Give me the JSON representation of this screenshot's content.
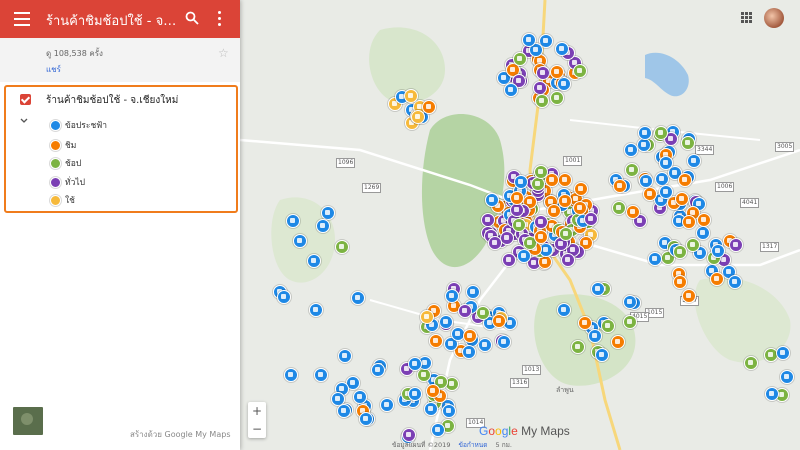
{
  "header": {
    "title": "ร้านค้าชิมช้อปใช้ - จ.เชียงใหม่",
    "color": "#db4437"
  },
  "info": {
    "views": "ดู 108,538 ครั้ง",
    "share": "แชร์"
  },
  "layer": {
    "name": "ร้านค้าชิมช้อปใช้ - จ.เชียงใหม่",
    "items": [
      {
        "label": "ข้อประชฟ้า",
        "color": "#1e88e5"
      },
      {
        "label": "ชิม",
        "color": "#f57c00"
      },
      {
        "label": "ช้อป",
        "color": "#7cb342"
      },
      {
        "label": "ทั่วไป",
        "color": "#7b3fb4"
      },
      {
        "label": "ใช้",
        "color": "#f6b93b"
      }
    ]
  },
  "footer_panel": {
    "credit": "สร้างด้วย Google My Maps"
  },
  "map": {
    "logo": "Google My Maps",
    "attribution": "ข้อมูลแผนที่ ©2019",
    "terms": "ข้อกำหนด",
    "scale": "5 กม.",
    "zoom_in": "+",
    "zoom_out": "−",
    "road_labels": [
      "1096",
      "1269",
      "1001",
      "3344",
      "3005",
      "1006",
      "4041",
      "1317",
      "1147",
      "1015",
      "1013",
      "1316",
      "1014",
      "4015",
      "1269"
    ],
    "place_labels": [
      "ลำพูน"
    ]
  }
}
